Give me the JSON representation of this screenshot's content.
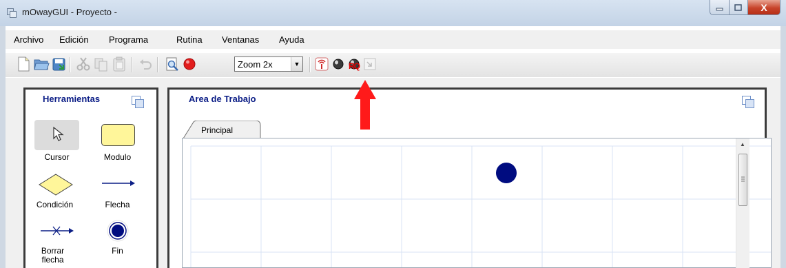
{
  "window": {
    "title": "mOwayGUI - Proyecto -",
    "close_label": "X"
  },
  "menu": [
    "Archivo",
    "Edición",
    "Programa",
    "Rutina",
    "Ventanas",
    "Ayuda"
  ],
  "toolbar": {
    "zoom_value": "Zoom 2x",
    "debug_icon_text": "RQ"
  },
  "tools_panel": {
    "title": "Herramientas",
    "tools": [
      {
        "label": "Cursor",
        "icon": "cursor-icon"
      },
      {
        "label": "Modulo",
        "icon": "module-icon"
      },
      {
        "label": "Condición",
        "icon": "condition-diamond-icon"
      },
      {
        "label": "Flecha",
        "icon": "arrow-icon"
      },
      {
        "label": "Borrar flecha",
        "icon": "delete-arrow-icon"
      },
      {
        "label": "Fin",
        "icon": "end-icon"
      }
    ]
  },
  "work_area": {
    "title": "Area de Trabajo",
    "tab": "Principal"
  },
  "colors": {
    "panel_title": "#0b1d86",
    "end_node": "#000c80",
    "annotation_arrow": "#ff1a1a"
  }
}
